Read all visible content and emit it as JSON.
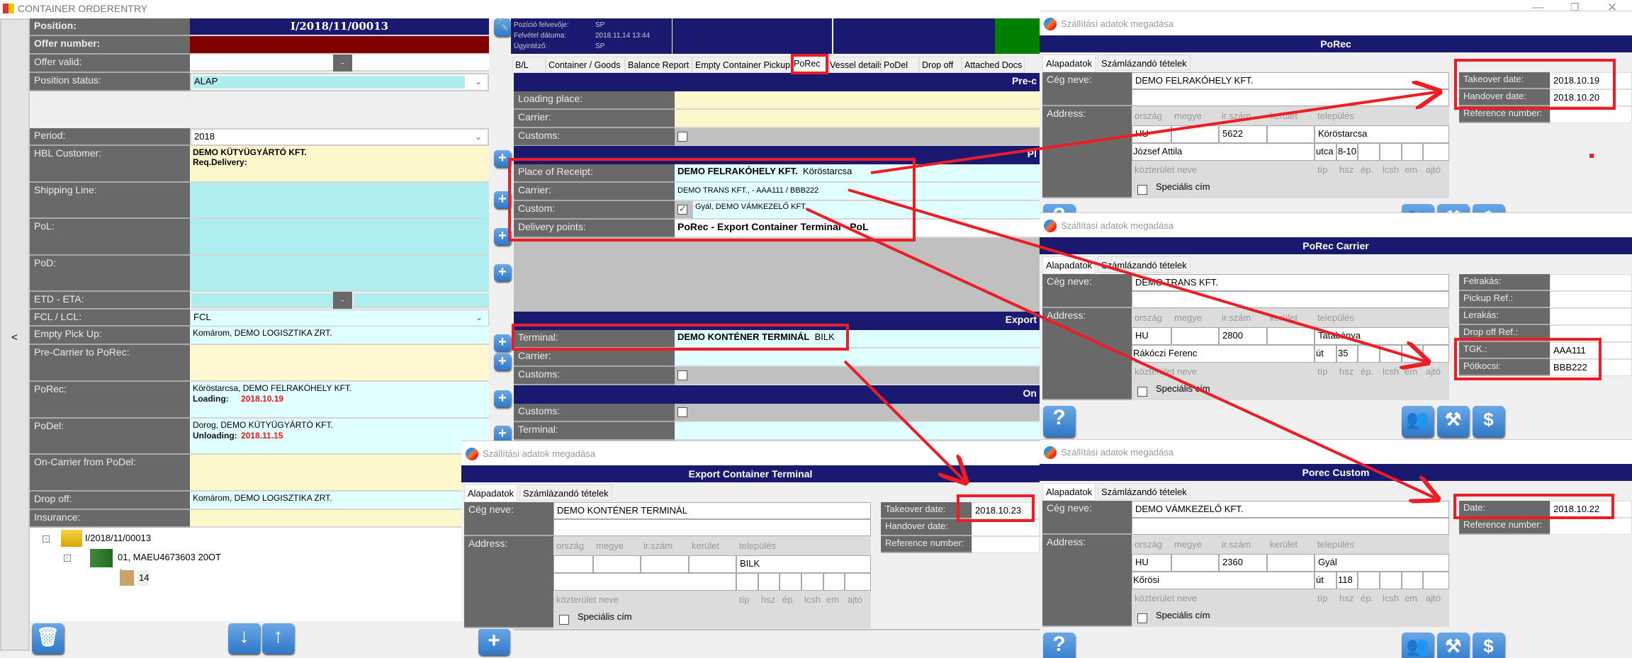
{
  "window": {
    "title": "CONTAINER ORDERENTRY",
    "controls": [
      "minimize",
      "maximize",
      "close"
    ]
  },
  "colors": {
    "navy": "#191970",
    "offer_red": "#800000",
    "annotation_red": "#ee1c25",
    "green": "#008000",
    "label_gray": "#696969"
  },
  "left_form": {
    "collapse": "<",
    "position": {
      "label": "Position:",
      "value": "I/2018/11/00013"
    },
    "offer_number": {
      "label": "Offer number:",
      "value": ""
    },
    "offer_valid": {
      "label": "Offer valid:",
      "from": "",
      "sep": "-",
      "to": ""
    },
    "position_status": {
      "label": "Position status:",
      "value": "ALAP"
    },
    "period": {
      "label": "Period:",
      "value": "2018"
    },
    "hbl_customer": {
      "label": "HBL Customer:",
      "value": "DEMO KÜTYÜGYÁRTÓ KFT.",
      "sub": "Req.Delivery:"
    },
    "shipping_line": {
      "label": "Shipping Line:"
    },
    "pol": {
      "label": "PoL:"
    },
    "pod": {
      "label": "PoD:"
    },
    "etd_eta": {
      "label": "ETD - ETA:",
      "sep": "-"
    },
    "fcl_lcl": {
      "label": "FCL / LCL:",
      "value": "FCL"
    },
    "empty_pickup": {
      "label": "Empty Pick Up:",
      "value": "Komárom, DEMO LOGISZTIKA ZRT."
    },
    "pre_carrier": {
      "label": "Pre-Carrier to PoRec:"
    },
    "porec": {
      "label": "PoRec:",
      "value": "Köröstarcsa, DEMO FELRAKÓHELY KFT.",
      "sub_label": "Loading:",
      "sub_date": "2018.10.19"
    },
    "podel": {
      "label": "PoDel:",
      "value": "Dorog, DEMO KÜTYÜGYÁRTÓ KFT.",
      "sub_label": "Unloading:",
      "sub_date": "2018.11.15"
    },
    "on_carrier": {
      "label": "On-Carrier from PoDel:"
    },
    "drop_off": {
      "label": "Drop off:",
      "value": "Komárom, DEMO LOGISZTIKA ZRT."
    },
    "insurance": {
      "label": "Insurance:"
    }
  },
  "tree": [
    {
      "label": "I/2018/11/00013"
    },
    {
      "label": "01, MAEU4673603 20OT"
    },
    {
      "label": "14"
    }
  ],
  "info": [
    {
      "label": "Pozíció felvevője:",
      "value": "SP"
    },
    {
      "label": "Felvétel dátuma:",
      "value": "2018.11.14 13:44"
    },
    {
      "label": "Ügyintéző:",
      "value": "SP"
    }
  ],
  "tabs": [
    "B/L",
    "Container / Goods",
    "Balance Report",
    "Empty Container Pickup",
    "PoRec",
    "Vessel details",
    "PoDel",
    "Drop off",
    "Attached Docs"
  ],
  "active_tab": "PoRec",
  "sections": {
    "pre": {
      "title": "Pre-c",
      "loading_place": "Loading place:",
      "carrier": "Carrier:",
      "customs": "Customs:"
    },
    "place": {
      "title": "Pl",
      "place_label": "Place of Receipt:",
      "place_name": "DEMO FELRAKÓHELY KFT.",
      "place_city": "Köröstarcsa",
      "carrier_label": "Carrier:",
      "carrier_value": "DEMO TRANS KFT., - AAA111 / BBB222",
      "custom_label": "Custom:",
      "custom_checked": true,
      "custom_value": "Gyál, DEMO VÁMKEZELŐ KFT.",
      "delivery_label": "Delivery points:",
      "delivery_value": "PoRec - Export Container Terminal - PoL"
    },
    "export": {
      "title": "Export",
      "terminal_label": "Terminal:",
      "terminal_name": "DEMO KONTÉNER TERMINÁL",
      "terminal_city": "BILK",
      "carrier_label": "Carrier:",
      "customs_label": "Customs:"
    },
    "on": {
      "title": "On",
      "customs_label": "Customs:",
      "terminal_label": "Terminal:"
    }
  },
  "dialog_common": {
    "window_title": "Szállítási adatok megadása",
    "tab1": "Alapadatok",
    "tab2": "Számlázandó tételek",
    "company_label": "Cég neve:",
    "address_label": "Address:",
    "addr_heads": [
      "ország",
      "megye",
      "ir.szám",
      "kerület",
      "település"
    ],
    "addr_heads2": [
      "közterület neve",
      "típ",
      "hsz",
      "ép.",
      "lcsh",
      "em",
      "ajtó"
    ],
    "special": "Speciális cím"
  },
  "dialogs": [
    {
      "header": "PoRec",
      "company": "DEMO FELRAKÓHELY KFT.",
      "country": "HU",
      "county": "",
      "zip": "5622",
      "district": "",
      "city": "Köröstarcsa",
      "street": "József Attila",
      "type": "utca",
      "number": "8-10",
      "fields": [
        {
          "label": "Takeover date:",
          "value": "2018.10.19"
        },
        {
          "label": "Handover date:",
          "value": "2018.10.20"
        },
        {
          "label": "Reference number:",
          "value": ""
        }
      ]
    },
    {
      "header": "PoRec Carrier",
      "company": "DEMO TRANS KFT.",
      "country": "HU",
      "county": "",
      "zip": "2800",
      "district": "",
      "city": "Tatabánya",
      "street": "Rákóczi Ferenc",
      "type": "út",
      "number": "35",
      "fields": [
        {
          "label": "Felrakás:",
          "value": ""
        },
        {
          "label": "Pickup Ref.:",
          "value": ""
        },
        {
          "label": "Lerakás:",
          "value": ""
        },
        {
          "label": "Drop off Ref.:",
          "value": ""
        },
        {
          "label": "TGK.:",
          "value": "AAA111"
        },
        {
          "label": "Pótkocsi:",
          "value": "BBB222"
        }
      ]
    },
    {
      "header": "Porec Custom",
      "company": "DEMO VÁMKEZELŐ KFT.",
      "country": "HU",
      "county": "",
      "zip": "2360",
      "district": "",
      "city": "Gyál",
      "street": "Kőrösi",
      "type": "út",
      "number": "118",
      "fields": [
        {
          "label": "Date:",
          "value": "2018.10.22"
        },
        {
          "label": "Reference number:",
          "value": ""
        }
      ]
    },
    {
      "header": "Export Container Terminal",
      "company": "DEMO KONTÉNER TERMINÁL",
      "country": "",
      "county": "",
      "zip": "",
      "district": "",
      "city": "BILK",
      "street": "",
      "type": "",
      "number": "",
      "fields": [
        {
          "label": "Takeover date:",
          "value": "2018.10.23"
        },
        {
          "label": "Handover date:",
          "value": ""
        },
        {
          "label": "Reference number:",
          "value": ""
        }
      ]
    }
  ]
}
